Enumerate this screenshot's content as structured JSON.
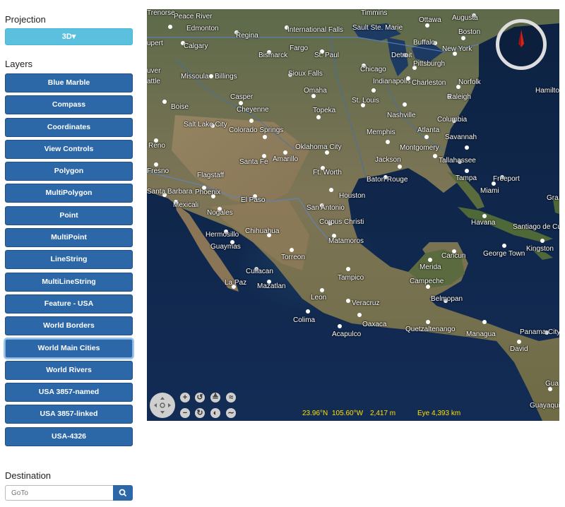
{
  "sidebar": {
    "projection_title": "Projection",
    "projection_value": "3D▾",
    "layers_title": "Layers",
    "layers": [
      {
        "label": "Blue Marble"
      },
      {
        "label": "Compass"
      },
      {
        "label": "Coordinates"
      },
      {
        "label": "View Controls"
      },
      {
        "label": "Polygon"
      },
      {
        "label": "MultiPolygon"
      },
      {
        "label": "Point"
      },
      {
        "label": "MultiPoint"
      },
      {
        "label": "LineString"
      },
      {
        "label": "MultiLineString"
      },
      {
        "label": "Feature - USA"
      },
      {
        "label": "World Borders"
      },
      {
        "label": "World Main Cities"
      },
      {
        "label": "World Rivers"
      },
      {
        "label": "USA 3857-named"
      },
      {
        "label": "USA 3857-linked"
      },
      {
        "label": "USA-4326"
      }
    ],
    "destination_title": "Destination",
    "goto_placeholder": "GoTo"
  },
  "map": {
    "status": {
      "lat": "23.96°N",
      "lon": "105.60°W",
      "alt": "2,417 m",
      "eye": "Eye  4,393 km"
    },
    "cities": [
      {
        "name": "Peace River"
      },
      {
        "name": "Edmonton"
      },
      {
        "name": "Regina"
      },
      {
        "name": "International Falls"
      },
      {
        "name": "Sault Ste. Marie"
      },
      {
        "name": "Ottawa"
      },
      {
        "name": "Augusta"
      },
      {
        "name": "Boston"
      },
      {
        "name": "Calgary"
      },
      {
        "name": "Bismarck"
      },
      {
        "name": "Fargo"
      },
      {
        "name": "St. Paul"
      },
      {
        "name": "Detroit"
      },
      {
        "name": "Buffalo"
      },
      {
        "name": "New York"
      },
      {
        "name": "Pittsburgh"
      },
      {
        "name": "Missoula"
      },
      {
        "name": "Billings"
      },
      {
        "name": "Sioux Falls"
      },
      {
        "name": "Chicago"
      },
      {
        "name": "Indianapolis"
      },
      {
        "name": "Charleston"
      },
      {
        "name": "Norfolk"
      },
      {
        "name": "Hamilton"
      },
      {
        "name": "Boise"
      },
      {
        "name": "Casper"
      },
      {
        "name": "Omaha"
      },
      {
        "name": "St. Louis"
      },
      {
        "name": "Raleigh"
      },
      {
        "name": "Cheyenne"
      },
      {
        "name": "Topeka"
      },
      {
        "name": "Nashville"
      },
      {
        "name": "Salt Lake City"
      },
      {
        "name": "Colorado Springs"
      },
      {
        "name": "Columbia"
      },
      {
        "name": "Memphis"
      },
      {
        "name": "Atlanta"
      },
      {
        "name": "Savannah"
      },
      {
        "name": "Reno"
      },
      {
        "name": "Oklahoma City"
      },
      {
        "name": "Montgomery"
      },
      {
        "name": "Santa Fe"
      },
      {
        "name": "Amarillo"
      },
      {
        "name": "Jackson"
      },
      {
        "name": "Tallahassee"
      },
      {
        "name": "Fresno"
      },
      {
        "name": "Flagstaff"
      },
      {
        "name": "Ft. Worth"
      },
      {
        "name": "Baton Rouge"
      },
      {
        "name": "Freeport"
      },
      {
        "name": "Tampa"
      },
      {
        "name": "Santa Barbara"
      },
      {
        "name": "Phoenix"
      },
      {
        "name": "Miami"
      },
      {
        "name": "El Paso"
      },
      {
        "name": "Houston"
      },
      {
        "name": "Mexicali"
      },
      {
        "name": "San Antonio"
      },
      {
        "name": "Nogales"
      },
      {
        "name": "Corpus Christi"
      },
      {
        "name": "Havana"
      },
      {
        "name": "Santiago de Cu"
      },
      {
        "name": "Hermosillo"
      },
      {
        "name": "Chihuahua"
      },
      {
        "name": "Matamoros"
      },
      {
        "name": "Guaymas"
      },
      {
        "name": "Torreon"
      },
      {
        "name": "Cancun"
      },
      {
        "name": "George Town"
      },
      {
        "name": "Kingston"
      },
      {
        "name": "Merida"
      },
      {
        "name": "Culiacan"
      },
      {
        "name": "Tampico"
      },
      {
        "name": "La Paz"
      },
      {
        "name": "Mazatlan"
      },
      {
        "name": "Campeche"
      },
      {
        "name": "Leon"
      },
      {
        "name": "Belmopan"
      },
      {
        "name": "Veracruz"
      },
      {
        "name": "Colima"
      },
      {
        "name": "Oaxaca"
      },
      {
        "name": "Quetzaltenango"
      },
      {
        "name": "Acapulco"
      },
      {
        "name": "Managua"
      },
      {
        "name": "Panama City"
      },
      {
        "name": "David"
      },
      {
        "name": "Guayaquil"
      },
      {
        "name": "Gua"
      },
      {
        "name": "Gra"
      },
      {
        "name": "Timmins"
      },
      {
        "name": "Trenorse"
      },
      {
        "name": "upert"
      },
      {
        "name": "uver"
      },
      {
        "name": "attle"
      }
    ]
  }
}
